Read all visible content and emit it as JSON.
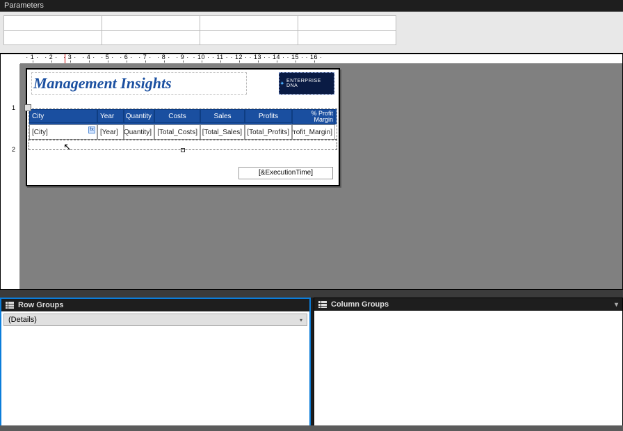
{
  "parameters_label": "Parameters",
  "ruler": {
    "numbers": [
      "1",
      "2",
      "3",
      "4",
      "5",
      "6",
      "7",
      "8",
      "9",
      "10",
      "11",
      "12",
      "13",
      "14",
      "15",
      "16"
    ]
  },
  "vruler": [
    "1",
    "2"
  ],
  "report": {
    "title": "Management Insights",
    "logo_text": "ENTERPRISE DNA",
    "exec_time": "[&ExecutionTime]"
  },
  "table": {
    "headers": {
      "city": "City",
      "year": "Year",
      "quantity": "Quantity",
      "costs": "Costs",
      "sales": "Sales",
      "profits": "Profits",
      "margin1": "% Profit",
      "margin2": "Margin"
    },
    "row": {
      "city": "[City]",
      "year": "[Year]",
      "quantity": "Quantity]",
      "costs": "[Total_Costs]",
      "sales": "[Total_Sales]",
      "profits": "[Total_Profits]",
      "margin": "Profit_Margin]"
    }
  },
  "groups": {
    "row_label": "Row Groups",
    "col_label": "Column Groups",
    "details_item": "(Details)"
  }
}
